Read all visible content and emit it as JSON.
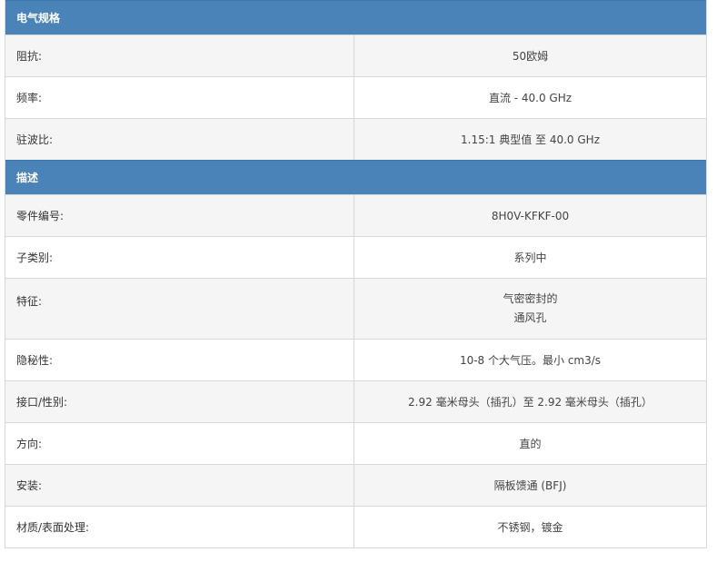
{
  "sections": [
    {
      "title": "电气规格",
      "rows": [
        {
          "label": "阻抗:",
          "value": "50欧姆"
        },
        {
          "label": "频率:",
          "value": "直流 - 40.0 GHz"
        },
        {
          "label": "驻波比:",
          "value": "1.15:1 典型值 至 40.0 GHz"
        }
      ]
    },
    {
      "title": "描述",
      "rows": [
        {
          "label": "零件编号:",
          "value": "8H0V-KFKF-00"
        },
        {
          "label": "子类别:",
          "value": "系列中"
        },
        {
          "label": "特征:",
          "value_lines": [
            "气密密封的",
            "通风孔"
          ]
        },
        {
          "label": "隐秘性:",
          "value": "10-8 个大气压。最小 cm3/s"
        },
        {
          "label": "接口/性别:",
          "value": "2.92 毫米母头（插孔）至 2.92 毫米母头（插孔）"
        },
        {
          "label": "方向:",
          "value": "直的"
        },
        {
          "label": "安装:",
          "value": "隔板馈通 (BFJ)"
        },
        {
          "label": "材质/表面处理:",
          "value": "不锈钢，镀金"
        }
      ]
    }
  ]
}
